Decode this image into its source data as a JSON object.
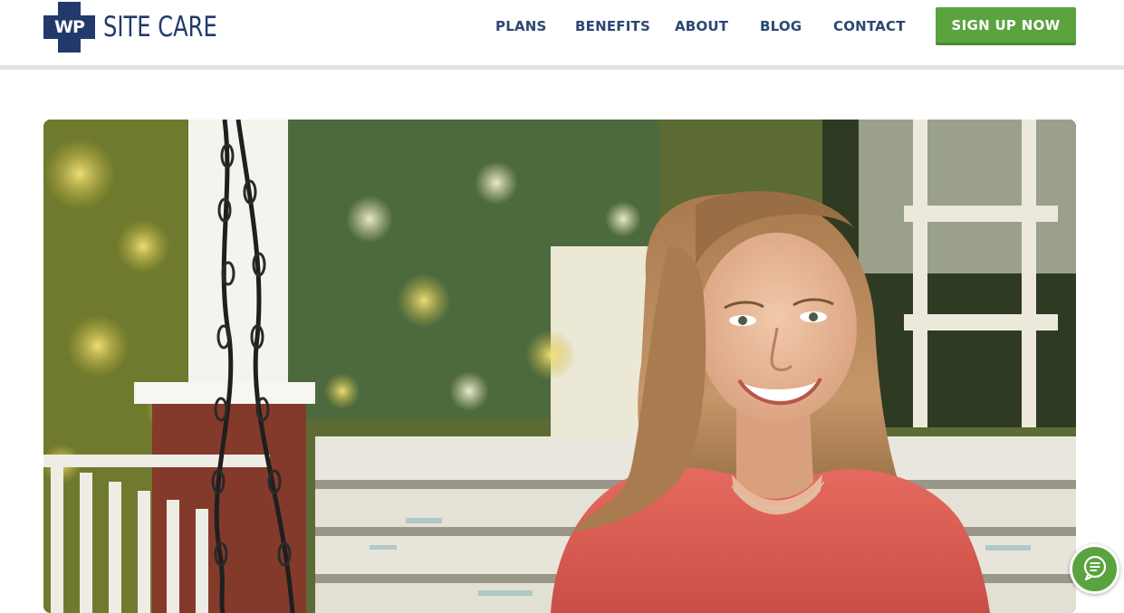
{
  "header": {
    "logo": {
      "mark_text": "WP",
      "wordmark": "SITE CARE"
    },
    "nav": [
      {
        "label": "PLANS"
      },
      {
        "label": "BENEFITS"
      },
      {
        "label": "ABOUT"
      },
      {
        "label": "BLOG"
      },
      {
        "label": "CONTACT"
      }
    ],
    "cta_label": "SIGN UP NOW"
  },
  "hero": {
    "image_alt": "Smiling woman sitting on a white porch swing"
  },
  "chat": {
    "icon": "chat-icon"
  },
  "colors": {
    "brand_navy": "#223a6b",
    "nav_text": "#2b4773",
    "cta_green": "#5aa33f"
  }
}
